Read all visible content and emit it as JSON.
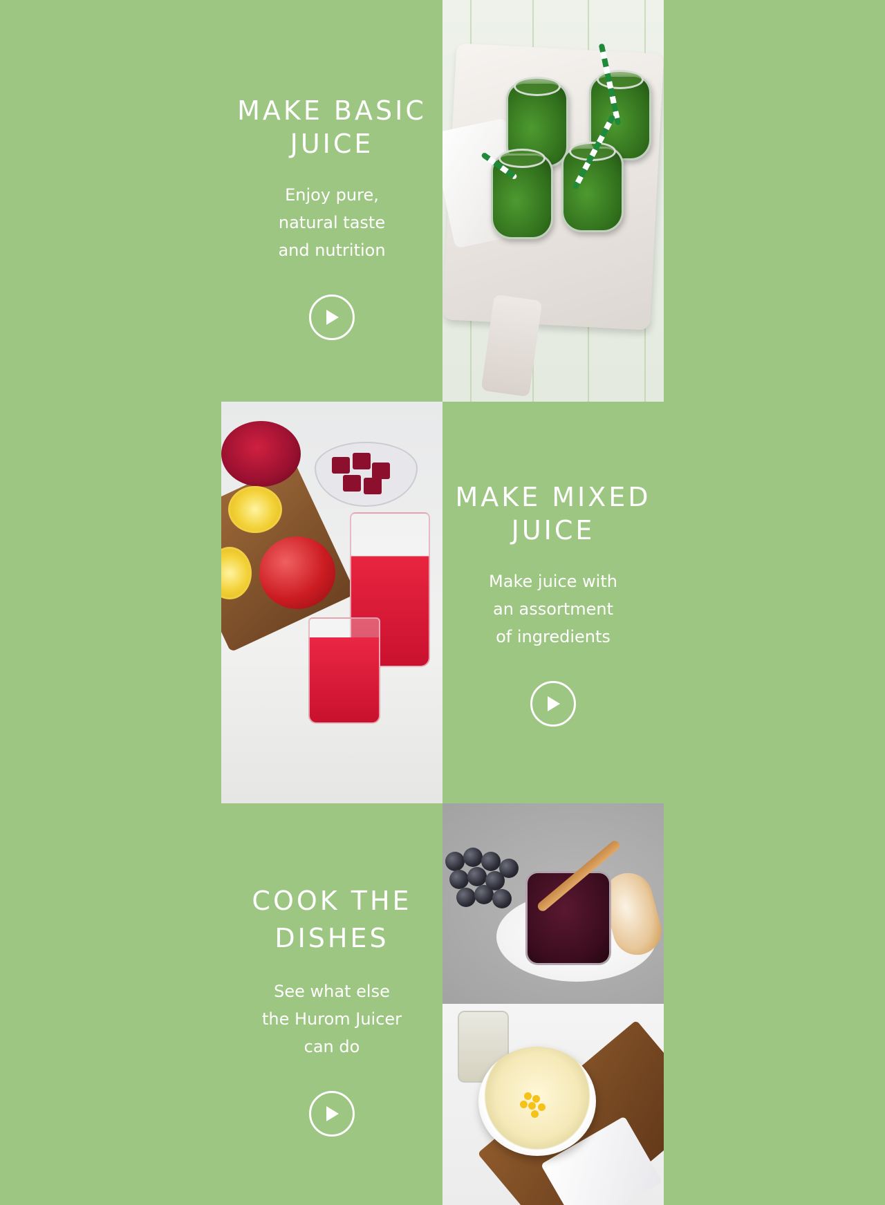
{
  "sections": [
    {
      "title_line1": "MAKE BASIC",
      "title_line2": "JUICE",
      "desc_line1": "Enjoy pure,",
      "desc_line2": "natural taste",
      "desc_line3": "and nutrition",
      "play_icon": "play-icon"
    },
    {
      "title_line1": "MAKE MIXED",
      "title_line2": "JUICE",
      "desc_line1": "Make juice with",
      "desc_line2": "an assortment",
      "desc_line3": "of ingredients",
      "play_icon": "play-icon"
    },
    {
      "title_line1": "COOK THE",
      "title_line2": "DISHES",
      "desc_line1": "See what else",
      "desc_line2": "the Hurom Juicer",
      "desc_line3": "can do",
      "play_icon": "play-icon"
    }
  ],
  "colors": {
    "background": "#9dc682",
    "text": "#ffffff"
  }
}
